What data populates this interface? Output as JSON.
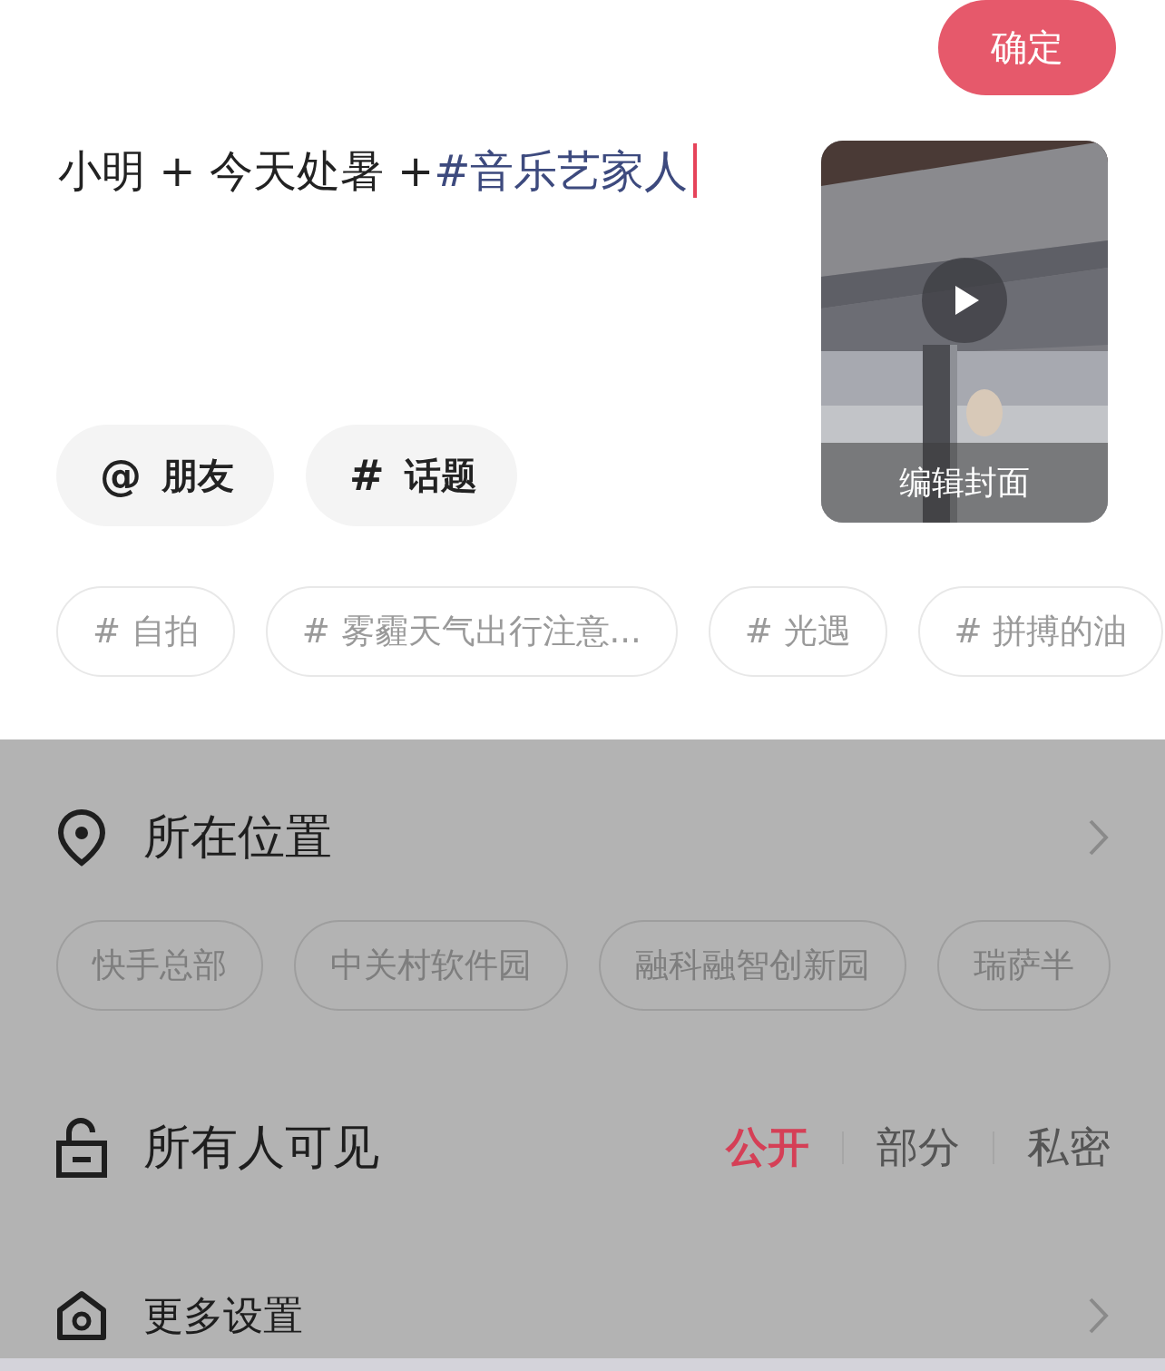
{
  "confirm_button": "确定",
  "caption": [
    {
      "kind": "plain",
      "text": "小明 + 今天处暑 +"
    },
    {
      "kind": "topic",
      "text": "#音乐艺家人"
    }
  ],
  "cover": {
    "kind": "picture",
    "label": "编辑封面"
  },
  "insert_buttons": [
    {
      "icon": "@",
      "label": "朋友"
    },
    {
      "icon": "#",
      "label": "话题"
    }
  ],
  "topic_suggestions": [
    "# 自拍",
    "# 雾霾天气出行注意...",
    "# 光遇",
    "# 拼搏的油"
  ],
  "location": {
    "label": "所在位置",
    "suggestions": [
      "快手总部",
      "中关村软件园",
      "融科融智创新园",
      "瑞萨半"
    ]
  },
  "visibility": {
    "label": "所有人可见",
    "options": [
      {
        "label": "公开",
        "selected": true
      },
      {
        "label": "部分",
        "selected": false
      },
      {
        "label": "私密",
        "selected": false
      }
    ]
  },
  "more_settings": {
    "label": "更多设置"
  }
}
